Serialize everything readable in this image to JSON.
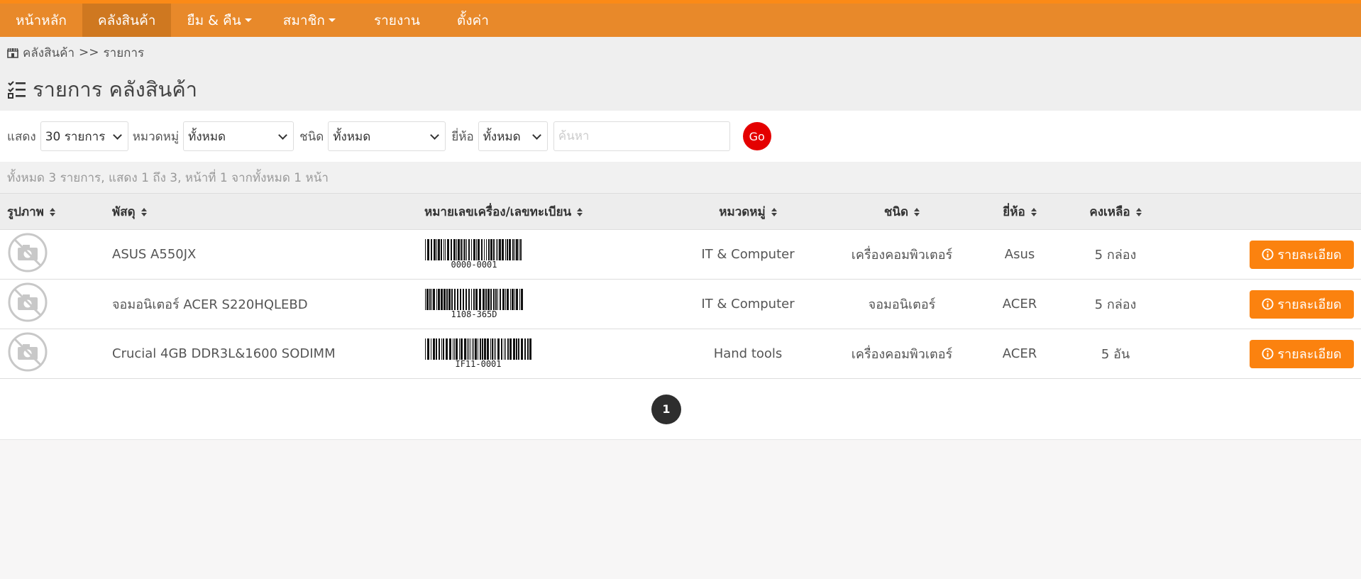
{
  "nav": {
    "items": [
      {
        "label": "หน้าหลัก"
      },
      {
        "label": "คลังสินค้า"
      },
      {
        "label": "ยืม & คืน"
      },
      {
        "label": "สมาชิก"
      },
      {
        "label": "รายงาน"
      },
      {
        "label": "ตั้งค่า"
      }
    ]
  },
  "breadcrumb": {
    "root": "คลังสินค้า",
    "separator": ">>",
    "current": "รายการ"
  },
  "page": {
    "title": "รายการ คลังสินค้า"
  },
  "filters": {
    "show_label": "แสดง",
    "show_value": "30 รายการ",
    "category_label": "หมวดหมู่",
    "category_value": "ทั้งหมด",
    "type_label": "ชนิด",
    "type_value": "ทั้งหมด",
    "brand_label": "ยี่ห้อ",
    "brand_value": "ทั้งหมด",
    "search_placeholder": "ค้นหา",
    "go_label": "Go"
  },
  "summary": "ทั้งหมด 3 รายการ, แสดง 1 ถึง 3, หน้าที่ 1 จากทั้งหมด 1 หน้า",
  "table": {
    "headers": {
      "image": "รูปภาพ",
      "item": "พัสดุ",
      "serial": "หมายเลขเครื่อง/เลขทะเบียน",
      "category": "หมวดหมู่",
      "type": "ชนิด",
      "brand": "ยี่ห้อ",
      "remaining": "คงเหลือ"
    },
    "rows": [
      {
        "item": "ASUS A550JX",
        "serial": "0000-0001",
        "category": "IT & Computer",
        "type": "เครื่องคอมพิวเตอร์",
        "brand": "Asus",
        "remaining": "5 กล่อง",
        "action": "รายละเอียด"
      },
      {
        "item": "จอมอนิเตอร์ ACER S220HQLEBD",
        "serial": "1108-365D",
        "category": "IT & Computer",
        "type": "จอมอนิเตอร์",
        "brand": "ACER",
        "remaining": "5 กล่อง",
        "action": "รายละเอียด"
      },
      {
        "item": "Crucial 4GB DDR3L&1600 SODIMM",
        "serial": "IF11-0001",
        "category": "Hand tools",
        "type": "เครื่องคอมพิวเตอร์",
        "brand": "ACER",
        "remaining": "5 อัน",
        "action": "รายละเอียด"
      }
    ]
  },
  "pagination": {
    "current": "1"
  },
  "colors": {
    "nav_bg": "#e8892a",
    "nav_active": "#cf7820",
    "detail_button": "#fb820f",
    "go_button": "#e40000"
  },
  "icons": {
    "breadcrumb": "store-icon",
    "title": "checklist-icon",
    "no_image": "no-image-icon",
    "detail": "info-circle-icon"
  }
}
